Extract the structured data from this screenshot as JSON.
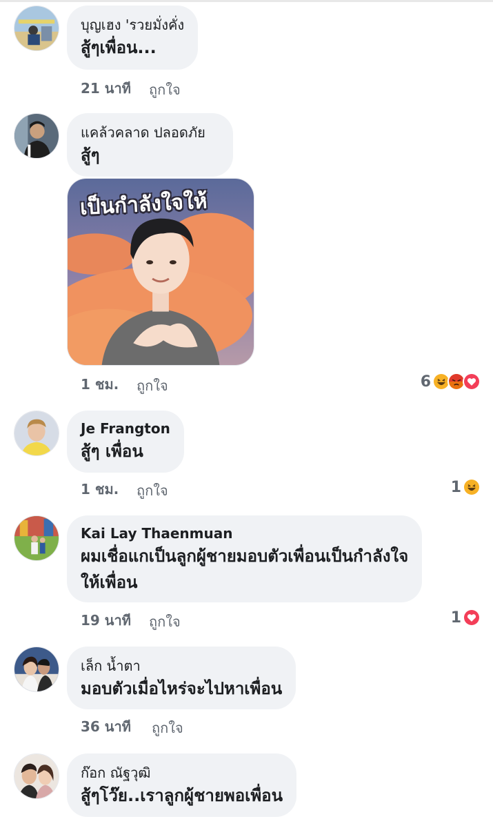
{
  "comments": [
    {
      "name": "บุญเฮง 'รวยมั่งคั่ง",
      "text": "สู้ๆเพื่อน...",
      "time": "21 นาที",
      "like_label": "ถูกใจ"
    },
    {
      "name": "แคล้วคลาด ปลอดภัย",
      "text": "สู้ๆ",
      "sticker_caption": "เป็นกำลังใจให้",
      "time": "1 ชม.",
      "like_label": "ถูกใจ",
      "reaction_count": "6",
      "reactions": [
        "haha-icon",
        "angry-icon",
        "love-icon"
      ]
    },
    {
      "name": "Je Frangton",
      "text": "สู้ๆ เพื่อน",
      "time": "1 ชม.",
      "like_label": "ถูกใจ",
      "reaction_count": "1",
      "reactions": [
        "haha-icon"
      ]
    },
    {
      "name": "Kai Lay Thaenmuan",
      "text_line1": "ผมเชื่อแกเป็นลูกผู้ชายมอบตัวเพื่อนเป็นกำลังใจ",
      "text_line2": "ให้เพื่อน",
      "time": "19 นาที",
      "like_label": "ถูกใจ",
      "reaction_count": "1",
      "reactions": [
        "love-icon"
      ]
    },
    {
      "name": "เล็ก น้ำตา",
      "text": "มอบตัวเมื่อไหร่จะไปหาเพื่อน",
      "time": "36 นาที",
      "like_label": "ถูกใจ"
    },
    {
      "name": "ก๊อก ณัฐวุฒิ",
      "text": "สู้ๆโว๊ย..เราลูกผู้ชายพอเพื่อน"
    }
  ],
  "colors": {
    "bubble": "#f0f2f5",
    "meta_text": "#606770",
    "haha": "#f7b125",
    "angry": "#e9710f",
    "love": "#f33e58"
  }
}
